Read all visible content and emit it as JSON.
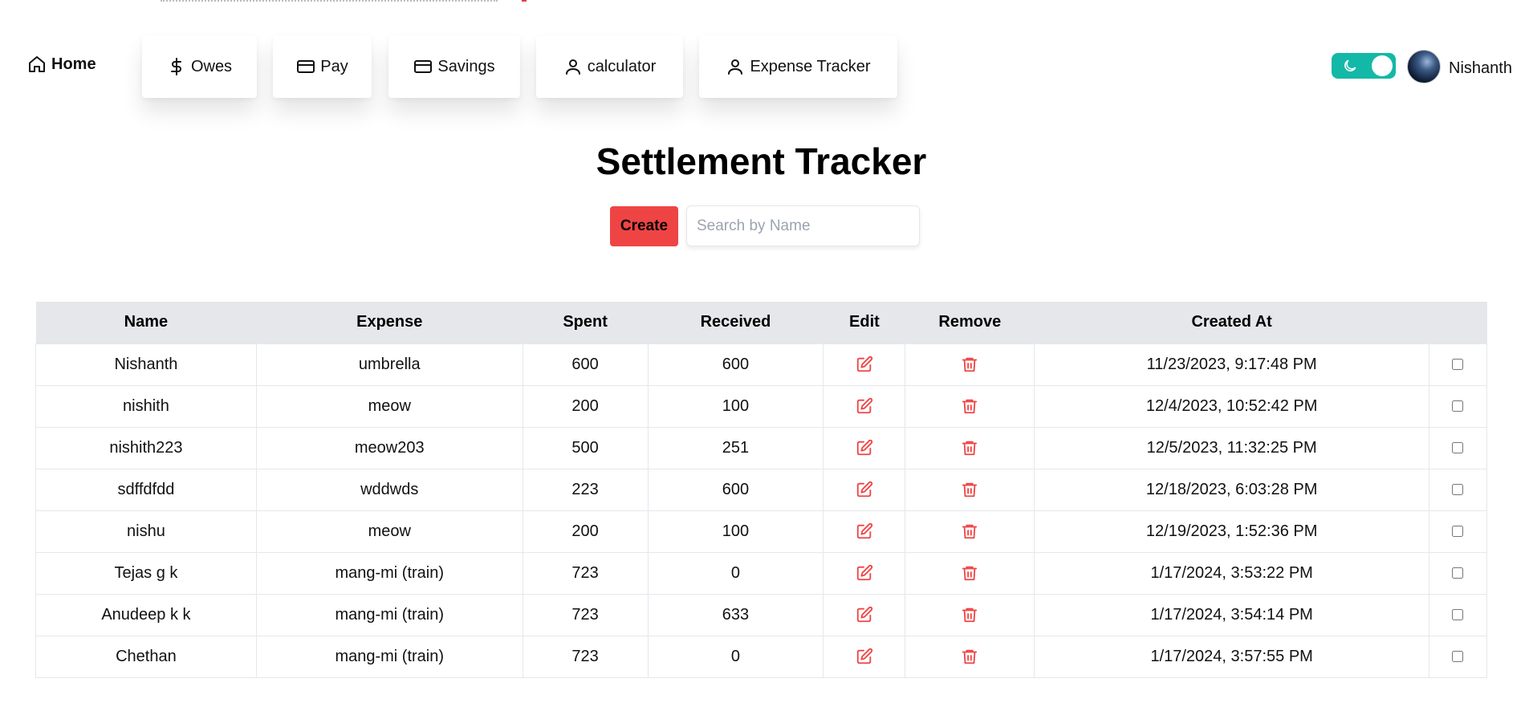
{
  "nav": {
    "home": "Home",
    "items": [
      {
        "label": "Owes",
        "icon": "dollar-icon"
      },
      {
        "label": "Pay",
        "icon": "credit-card-icon"
      },
      {
        "label": "Savings",
        "icon": "credit-card-icon"
      },
      {
        "label": "calculator",
        "icon": "user-icon"
      },
      {
        "label": "Expense Tracker",
        "icon": "user-icon"
      }
    ],
    "theme_toggle_on": true,
    "username": "Nishanth"
  },
  "page_title": "Settlement Tracker",
  "create_label": "Create",
  "search": {
    "placeholder": "Search by Name",
    "value": ""
  },
  "table": {
    "columns": [
      "Name",
      "Expense",
      "Spent",
      "Received",
      "Edit",
      "Remove",
      "Created At",
      ""
    ],
    "rows": [
      {
        "name": "Nishanth",
        "expense": "umbrella",
        "spent": "600",
        "received": "600",
        "created_at": "11/23/2023, 9:17:48 PM"
      },
      {
        "name": "nishith",
        "expense": "meow",
        "spent": "200",
        "received": "100",
        "created_at": "12/4/2023, 10:52:42 PM"
      },
      {
        "name": "nishith223",
        "expense": "meow203",
        "spent": "500",
        "received": "251",
        "created_at": "12/5/2023, 11:32:25 PM"
      },
      {
        "name": "sdffdfdd",
        "expense": "wddwds",
        "spent": "223",
        "received": "600",
        "created_at": "12/18/2023, 6:03:28 PM"
      },
      {
        "name": "nishu",
        "expense": "meow",
        "spent": "200",
        "received": "100",
        "created_at": "12/19/2023, 1:52:36 PM"
      },
      {
        "name": "Tejas g k",
        "expense": "mang-mi (train)",
        "spent": "723",
        "received": "0",
        "created_at": "1/17/2024, 3:53:22 PM"
      },
      {
        "name": "Anudeep k k",
        "expense": "mang-mi (train)",
        "spent": "723",
        "received": "633",
        "created_at": "1/17/2024, 3:54:14 PM"
      },
      {
        "name": "Chethan",
        "expense": "mang-mi (train)",
        "spent": "723",
        "received": "0",
        "created_at": "1/17/2024, 3:57:55 PM"
      }
    ]
  },
  "colors": {
    "accent_red": "#ef4444",
    "toggle_teal": "#14b8a6",
    "header_bg": "#e5e7eb"
  }
}
